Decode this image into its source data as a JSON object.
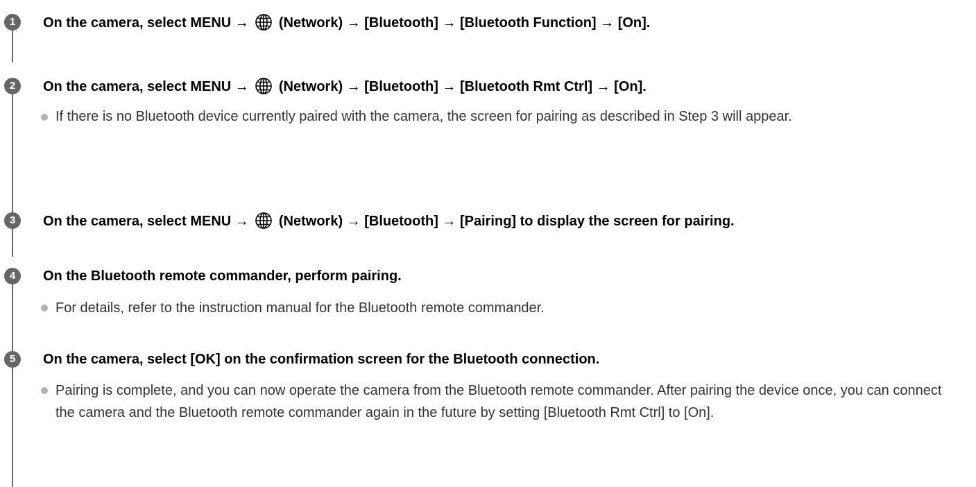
{
  "steps": [
    {
      "number": "1",
      "title_parts": [
        "On the camera, select MENU → ",
        "globe-icon",
        " (Network) → [Bluetooth] → [Bluetooth Function] → [On]."
      ],
      "pre": "On the camera, select MENU → ",
      "post": " (Network) → [Bluetooth] → [Bluetooth Function] → [On]."
    },
    {
      "number": "2",
      "pre": "On the camera, select MENU → ",
      "post": " (Network) → [Bluetooth] → [Bluetooth Rmt Ctrl] → [On].",
      "note": "If there is no Bluetooth device currently paired with the camera, the screen for pairing as described in Step 3 will appear."
    },
    {
      "number": "3",
      "pre": "On the camera, select MENU → ",
      "post": " (Network) → [Bluetooth] → [Pairing] to display the screen for pairing."
    },
    {
      "number": "4",
      "title": "On the Bluetooth remote commander, perform pairing.",
      "note": "For details, refer to the instruction manual for the Bluetooth remote commander."
    },
    {
      "number": "5",
      "title": "On the camera, select [OK] on the confirmation screen for the Bluetooth connection.",
      "note": "Pairing is complete, and you can now operate the camera from the Bluetooth remote commander. After pairing the device once, you can connect the camera and the Bluetooth remote commander again in the future by setting [Bluetooth Rmt Ctrl] to [On]."
    }
  ],
  "icons": {
    "network": "globe-icon"
  },
  "colors": {
    "step_circle": "#666666",
    "bullet": "#b3b3b3",
    "text": "#000000",
    "note_text": "#333333"
  }
}
